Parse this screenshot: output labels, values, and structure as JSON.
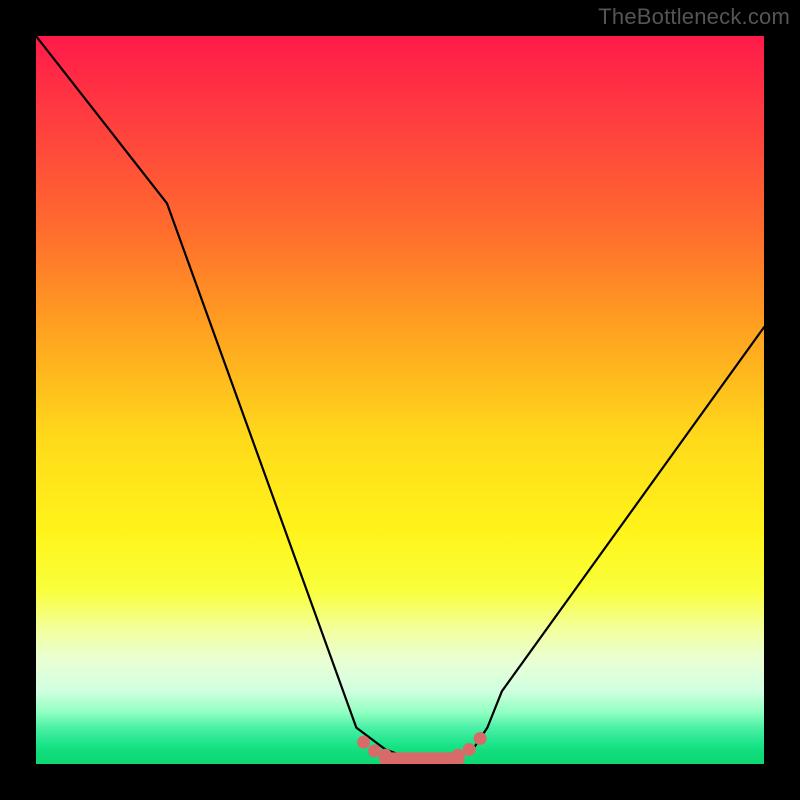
{
  "watermark": "TheBottleneck.com",
  "chart_data": {
    "type": "line",
    "title": "",
    "xlabel": "",
    "ylabel": "",
    "xlim": [
      0,
      100
    ],
    "ylim": [
      0,
      100
    ],
    "grid": false,
    "series": [
      {
        "name": "bottleneck-curve",
        "x": [
          0,
          18,
          44,
          48,
          52,
          56,
          60,
          62,
          64,
          100
        ],
        "y": [
          100,
          77,
          5,
          2,
          0.5,
          0.5,
          2,
          5,
          10,
          60
        ]
      }
    ],
    "dips": [
      {
        "name": "left-dip",
        "x": [
          45,
          46.5,
          48
        ],
        "y": [
          3.0,
          1.8,
          1.2
        ]
      },
      {
        "name": "right-dip",
        "x": [
          58,
          59.5,
          61
        ],
        "y": [
          1.2,
          2.0,
          3.5
        ]
      }
    ],
    "gradient_stops": [
      {
        "pos": 0,
        "color": "#ff1a4a"
      },
      {
        "pos": 0.55,
        "color": "#ffd91a"
      },
      {
        "pos": 0.93,
        "color": "#8effc0"
      },
      {
        "pos": 1.0,
        "color": "#0dd874"
      }
    ]
  }
}
